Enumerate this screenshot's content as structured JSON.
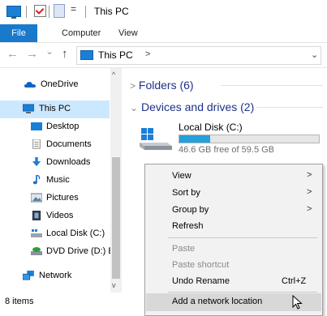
{
  "window": {
    "title": "This PC"
  },
  "quick_access": {
    "dropdown_glyph": "="
  },
  "ribbon": {
    "tabs": [
      {
        "label": "File"
      },
      {
        "label": "Computer"
      },
      {
        "label": "View"
      }
    ]
  },
  "address_bar": {
    "back": "←",
    "forward": "→",
    "recent": "⌄",
    "up": "↑",
    "path": "This PC",
    "separator": ">",
    "dropdown": "⌄"
  },
  "sidebar": {
    "items": [
      {
        "label": "OneDrive",
        "icon": "cloud-icon"
      },
      {
        "label": "This PC",
        "icon": "computer-icon",
        "selected": true
      },
      {
        "label": "Desktop",
        "icon": "desktop-icon"
      },
      {
        "label": "Documents",
        "icon": "documents-icon"
      },
      {
        "label": "Downloads",
        "icon": "downloads-icon"
      },
      {
        "label": "Music",
        "icon": "music-icon"
      },
      {
        "label": "Pictures",
        "icon": "pictures-icon"
      },
      {
        "label": "Videos",
        "icon": "videos-icon"
      },
      {
        "label": "Local Disk (C:)",
        "icon": "drive-icon"
      },
      {
        "label": "DVD Drive (D:) E",
        "icon": "dvd-drive-icon"
      },
      {
        "label": "Network",
        "icon": "network-icon"
      }
    ],
    "scroll_up": "^",
    "scroll_down": "v"
  },
  "main": {
    "folders_header": "Folders (6)",
    "folders_chevron": ">",
    "devices_header": "Devices and drives (2)",
    "devices_chevron": "⌄",
    "drive": {
      "name": "Local Disk (C:)",
      "free_text": "46.6 GB free of 59.5 GB",
      "used_fraction": 0.22
    }
  },
  "context_menu": {
    "items": [
      {
        "label": "View",
        "submenu": true,
        "arrow": ">"
      },
      {
        "label": "Sort by",
        "submenu": true,
        "arrow": ">"
      },
      {
        "label": "Group by",
        "submenu": true,
        "arrow": ">"
      },
      {
        "label": "Refresh"
      },
      {
        "label": "Paste",
        "disabled": true
      },
      {
        "label": "Paste shortcut",
        "disabled": true
      },
      {
        "label": "Undo Rename",
        "shortcut": "Ctrl+Z"
      },
      {
        "label": "Add a network location",
        "hover": true
      }
    ]
  },
  "status_bar": {
    "item_count": "8 items"
  },
  "colors": {
    "accent": "#1979ca",
    "selection": "#cce8ff",
    "drive_bar": "#26a0da",
    "group_header": "#1e3287"
  }
}
